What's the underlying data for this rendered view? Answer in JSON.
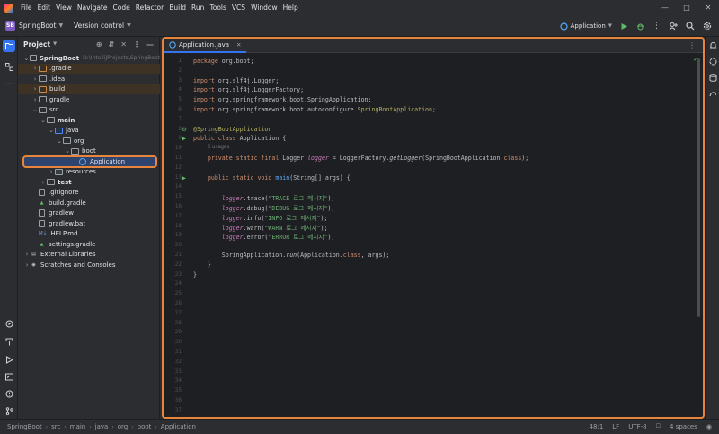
{
  "menu": [
    "File",
    "Edit",
    "View",
    "Navigate",
    "Code",
    "Refactor",
    "Build",
    "Run",
    "Tools",
    "VCS",
    "Window",
    "Help"
  ],
  "toolbar": {
    "project_badge": "SB",
    "project_name": "SpringBoot",
    "vcs": "Version control",
    "run_config": "Application"
  },
  "panel": {
    "title": "Project"
  },
  "tree": [
    {
      "label": "SpringBoot",
      "extra": "D:\\IntelliJProjects\\SpringBoot",
      "depth": 0,
      "arrow": "v",
      "kind": "folder-plain",
      "bold": true
    },
    {
      "label": ".gradle",
      "depth": 1,
      "arrow": ">",
      "kind": "folder-orange"
    },
    {
      "label": ".idea",
      "depth": 1,
      "arrow": ">",
      "kind": "folder-plain"
    },
    {
      "label": "build",
      "depth": 1,
      "arrow": ">",
      "kind": "folder-orange"
    },
    {
      "label": "gradle",
      "depth": 1,
      "arrow": ">",
      "kind": "folder-plain"
    },
    {
      "label": "src",
      "depth": 1,
      "arrow": "v",
      "kind": "folder-plain"
    },
    {
      "label": "main",
      "depth": 2,
      "arrow": "v",
      "kind": "folder-plain",
      "bold": true
    },
    {
      "label": "java",
      "depth": 3,
      "arrow": "v",
      "kind": "folder-blue"
    },
    {
      "label": "org",
      "depth": 4,
      "arrow": "v",
      "kind": "folder-plain"
    },
    {
      "label": "boot",
      "depth": 5,
      "arrow": "v",
      "kind": "folder-plain"
    },
    {
      "label": "Application",
      "depth": 6,
      "arrow": "",
      "kind": "java",
      "selected": true
    },
    {
      "label": "resources",
      "depth": 3,
      "arrow": ">",
      "kind": "folder-res"
    },
    {
      "label": "test",
      "depth": 2,
      "arrow": ">",
      "kind": "folder-plain",
      "bold": true
    },
    {
      "label": ".gitignore",
      "depth": 1,
      "arrow": "",
      "kind": "file"
    },
    {
      "label": "build.gradle",
      "depth": 1,
      "arrow": "",
      "kind": "gradle"
    },
    {
      "label": "gradlew",
      "depth": 1,
      "arrow": "",
      "kind": "file"
    },
    {
      "label": "gradlew.bat",
      "depth": 1,
      "arrow": "",
      "kind": "file"
    },
    {
      "label": "HELP.md",
      "depth": 1,
      "arrow": "",
      "kind": "md"
    },
    {
      "label": "settings.gradle",
      "depth": 1,
      "arrow": "",
      "kind": "gradle"
    },
    {
      "label": "External Libraries",
      "depth": 0,
      "arrow": ">",
      "kind": "lib"
    },
    {
      "label": "Scratches and Consoles",
      "depth": 0,
      "arrow": ">",
      "kind": "scratch"
    }
  ],
  "editor": {
    "tab_label": "Application.java",
    "usages_hint": "5 usages",
    "line_count": 37
  },
  "code_lines": [
    {
      "n": 1,
      "html": "<span class='kw'>package</span> org.boot;"
    },
    {
      "n": 3,
      "html": "<span class='kw'>import</span> org.slf4j.Logger;"
    },
    {
      "n": 4,
      "html": "<span class='kw'>import</span> org.slf4j.LoggerFactory;"
    },
    {
      "n": 5,
      "html": "<span class='kw'>import</span> org.springframework.boot.SpringApplication;"
    },
    {
      "n": 6,
      "html": "<span class='kw'>import</span> org.springframework.boot.autoconfigure.<span class='ann'>SpringBootApplication</span>;"
    },
    {
      "n": 8,
      "html": "<span class='ann'>@SpringBootApplication</span>"
    },
    {
      "n": 9,
      "html": "<span class='kw'>public class</span> Application {"
    },
    {
      "n": 11,
      "html": "    <span class='kw'>private static final</span> Logger <span class='fld itc'>logger</span> = LoggerFactory.<span class='itc'>getLogger</span>(SpringBootApplication.<span class='kw'>class</span>);"
    },
    {
      "n": 13,
      "html": "    <span class='kw'>public static void</span> <span class='fn'>main</span>(String[] args) {"
    },
    {
      "n": 15,
      "html": "        <span class='fld itc'>logger</span>.trace(<span class='str'>\"TRACE 로그 메시지\"</span>);"
    },
    {
      "n": 16,
      "html": "        <span class='fld itc'>logger</span>.debug(<span class='str'>\"DEBUG 로그 메시지\"</span>);"
    },
    {
      "n": 17,
      "html": "        <span class='fld itc'>logger</span>.info(<span class='str'>\"INFO 로그 메시지\"</span>);"
    },
    {
      "n": 18,
      "html": "        <span class='fld itc'>logger</span>.warn(<span class='str'>\"WARN 로그 메시지\"</span>);"
    },
    {
      "n": 19,
      "html": "        <span class='fld itc'>logger</span>.error(<span class='str'>\"ERROR 로그 메시지\"</span>);"
    },
    {
      "n": 21,
      "html": "        SpringApplication.<span class='itc'>run</span>(Application.<span class='kw'>class</span>, args);"
    },
    {
      "n": 22,
      "html": "    }"
    },
    {
      "n": 23,
      "html": "}"
    }
  ],
  "status": {
    "crumbs": [
      "SpringBoot",
      "src",
      "main",
      "java",
      "org",
      "boot",
      "Application"
    ],
    "position": "48:1",
    "line_sep": "LF",
    "encoding": "UTF-8",
    "indent": "4 spaces"
  },
  "colors": {
    "accent": "#3574f0",
    "highlight_border": "#e8853c",
    "selection": "#2e436e"
  }
}
